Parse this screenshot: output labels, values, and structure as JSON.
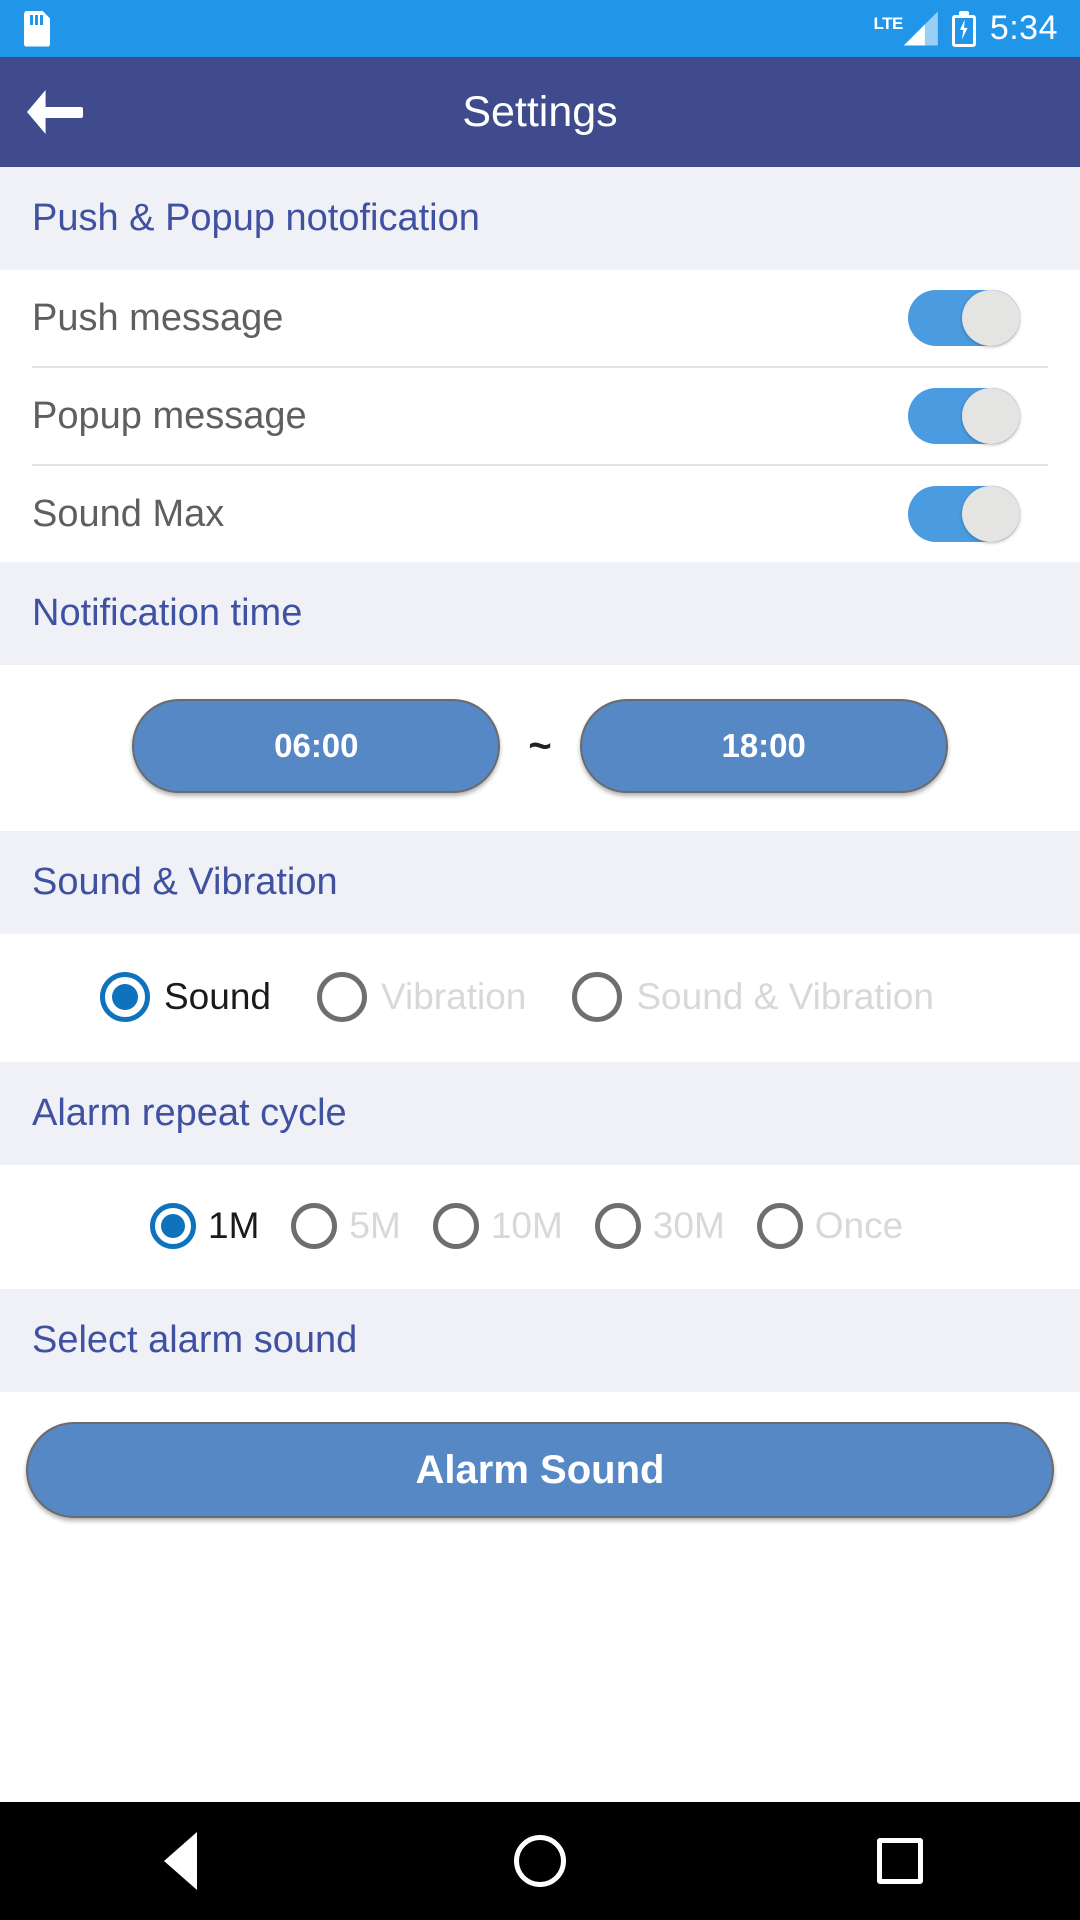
{
  "statusbar": {
    "sd_icon": "sd-card-icon",
    "network_label": "LTE",
    "signal_icon": "signal-bars-icon",
    "battery_icon": "battery-charging-icon",
    "time": "5:34"
  },
  "appbar": {
    "back_icon": "back-arrow-icon",
    "title": "Settings"
  },
  "sections": {
    "push_popup": {
      "header": "Push & Popup notofication",
      "toggles": [
        {
          "label": "Push message",
          "state": "on"
        },
        {
          "label": "Popup message",
          "state": "on"
        },
        {
          "label": "Sound Max",
          "state": "on"
        }
      ]
    },
    "notification_time": {
      "header": "Notification time",
      "start_time": "06:00",
      "separator": "~",
      "end_time": "18:00"
    },
    "sound_vibration": {
      "header": "Sound & Vibration",
      "options": [
        {
          "label": "Sound",
          "selected": true
        },
        {
          "label": "Vibration",
          "selected": false
        },
        {
          "label": "Sound & Vibration",
          "selected": false
        }
      ]
    },
    "alarm_repeat": {
      "header": "Alarm repeat cycle",
      "options": [
        {
          "label": "1M",
          "selected": true
        },
        {
          "label": "5M",
          "selected": false
        },
        {
          "label": "10M",
          "selected": false
        },
        {
          "label": "30M",
          "selected": false
        },
        {
          "label": "Once",
          "selected": false
        }
      ]
    },
    "select_alarm_sound": {
      "header": "Select alarm sound",
      "button_label": "Alarm Sound"
    }
  },
  "navbar": {
    "back_icon": "nav-back-icon",
    "home_icon": "nav-home-icon",
    "recents_icon": "nav-recents-icon"
  },
  "colors": {
    "statusbar_bg": "#2196E8",
    "appbar_bg": "#3F4B8C",
    "section_header_bg": "#EFF1F6",
    "section_header_text": "#3F51A0",
    "accent_blue": "#5588C4",
    "toggle_on": "#4A9BE0",
    "radio_selected": "#0E72BD"
  }
}
